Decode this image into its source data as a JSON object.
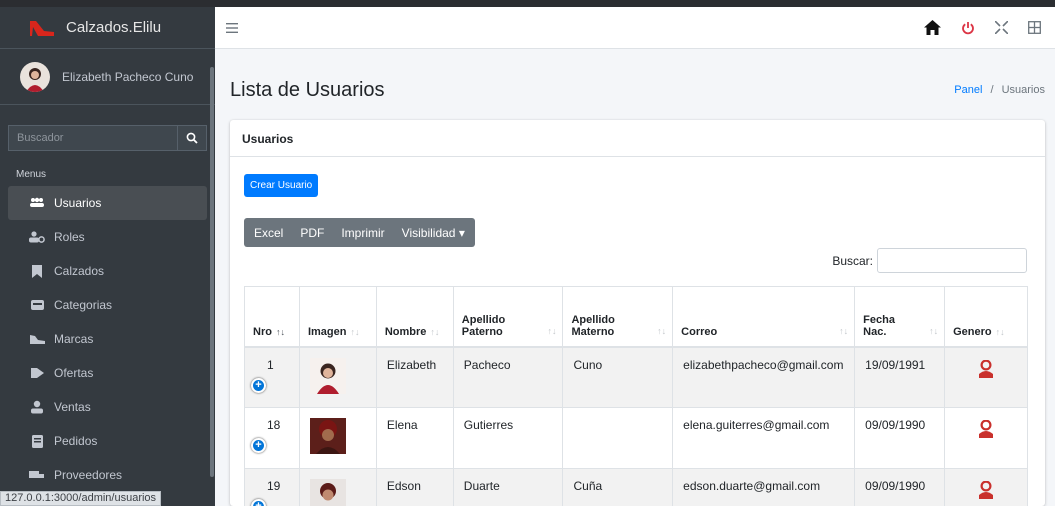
{
  "sidebar": {
    "brand": "Calzados.Elilu",
    "user_name": "Elizabeth Pacheco Cuno",
    "search_placeholder": "Buscador",
    "menus_header": "Menus",
    "items": [
      {
        "label": "Usuarios",
        "icon": "users-icon",
        "active": true
      },
      {
        "label": "Roles",
        "icon": "user-cog-icon",
        "active": false
      },
      {
        "label": "Calzados",
        "icon": "bookmark-icon",
        "active": false
      },
      {
        "label": "Categorias",
        "icon": "clipboard-icon",
        "active": false
      },
      {
        "label": "Marcas",
        "icon": "shoe-icon",
        "active": false
      },
      {
        "label": "Ofertas",
        "icon": "tag-icon",
        "active": false
      },
      {
        "label": "Ventas",
        "icon": "user-circle-icon",
        "active": false
      },
      {
        "label": "Pedidos",
        "icon": "receipt-icon",
        "active": false
      },
      {
        "label": "Proveedores",
        "icon": "truck-icon",
        "active": false
      }
    ]
  },
  "status_url": "127.0.0.1:3000/admin/usuarios",
  "header": {
    "title": "Lista de Usuarios",
    "breadcrumb_home": "Panel",
    "breadcrumb_sep": "/",
    "breadcrumb_current": "Usuarios"
  },
  "card": {
    "title": "Usuarios",
    "create_button": "Crear Usuario",
    "export_buttons": [
      "Excel",
      "PDF",
      "Imprimir",
      "Visibilidad ▾"
    ],
    "search_label": "Buscar:",
    "search_value": ""
  },
  "table": {
    "columns": [
      "Nro",
      "Imagen",
      "Nombre",
      "Apellido Paterno",
      "Apellido Materno",
      "Correo",
      "Fecha Nac.",
      "Genero"
    ],
    "rows": [
      {
        "nro": "1",
        "nombre": "Elizabeth",
        "paterno": "Pacheco",
        "materno": "Cuno",
        "correo": "elizabethpacheco@gmail.com",
        "fecha": "19/09/1991"
      },
      {
        "nro": "18",
        "nombre": "Elena",
        "paterno": "Gutierres",
        "materno": "",
        "correo": "elena.guiterres@gmail.com",
        "fecha": "09/09/1990"
      },
      {
        "nro": "19",
        "nombre": "Edson",
        "paterno": "Duarte",
        "materno": "Cuña",
        "correo": "edson.duarte@gmail.com",
        "fecha": "09/09/1990"
      }
    ]
  },
  "colors": {
    "sidebar": "#343a40",
    "accent": "#007bff",
    "gender": "#c9302c"
  }
}
